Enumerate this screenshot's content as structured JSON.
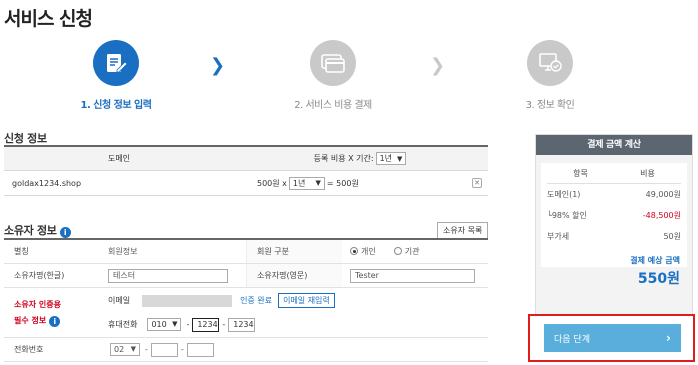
{
  "page_title": "서비스 신청",
  "steps": [
    {
      "number": "1.",
      "label": "신청 정보 입력",
      "state": "active",
      "icon": "edit-document-icon"
    },
    {
      "number": "2.",
      "label": "서비스 비용 결제",
      "state": "inactive",
      "icon": "credit-card-icon"
    },
    {
      "number": "3.",
      "label": "정보 확인",
      "state": "inactive",
      "icon": "monitor-check-icon"
    }
  ],
  "application": {
    "section_title": "신청 정보",
    "col_domain": "도메인",
    "col_period": "등록 비용 X 기간:",
    "period_select": "1년",
    "rows": [
      {
        "domain": "goldax1234.shop",
        "price": "500원 x",
        "period": "1년",
        "equals": "= 500원"
      }
    ]
  },
  "owner": {
    "section_title": "소유자 정보",
    "owner_list_button": "소유자 목록",
    "alias_label": "별칭",
    "alias_value": "회원정보",
    "member_type_label": "회원 구분",
    "member_type_options": [
      "개인",
      "기관"
    ],
    "member_type_selected": "개인",
    "name_kr_label": "소유자명(한글)",
    "name_kr_value": "테스터",
    "name_en_label": "소유자명(영문)",
    "name_en_value": "Tester",
    "auth_label_1": "소유자 인증용",
    "auth_label_2": "필수 정보",
    "email_label": "이메일",
    "auth_done": "인증 완료",
    "email_resend": "이메일 재입력",
    "mobile_label": "휴대전화",
    "mobile_prefix": "010",
    "mobile_mid": "1234",
    "mobile_last": "1234",
    "phone_label": "전화번호",
    "phone_prefix": "02",
    "phone_mid": "",
    "phone_last": ""
  },
  "payment": {
    "header": "결제 금액 계산",
    "col_item": "항목",
    "col_cost": "비용",
    "items": [
      {
        "label": "도메인(1)",
        "amount": "49,000원",
        "negative": false
      },
      {
        "label": "└98% 할인",
        "amount": "-48,500원",
        "negative": true
      },
      {
        "label": "부가세",
        "amount": "50원",
        "negative": false
      }
    ],
    "total_label": "결제 예상 금액",
    "total_value": "550원"
  },
  "next_button": "다음 단계",
  "colors": {
    "primary": "#1b6fc2",
    "step_inactive": "#c9c9c9",
    "required_red": "#d0021b",
    "next_button": "#5aaedc",
    "highlight_border": "#e21b1b",
    "panel_header": "#5c6670"
  }
}
